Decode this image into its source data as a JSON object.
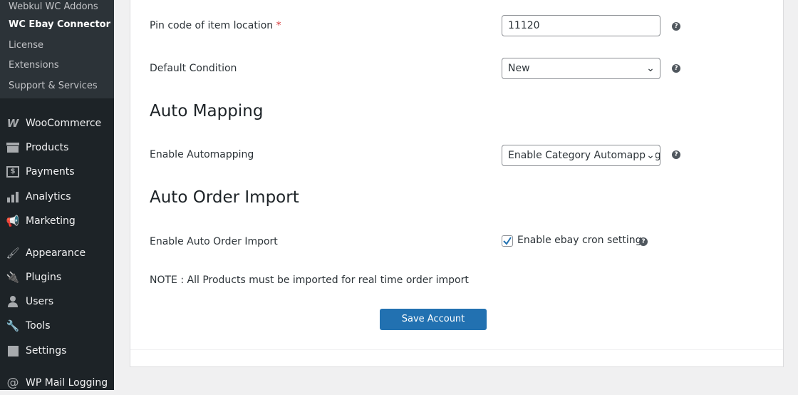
{
  "sidebar": {
    "submenu": [
      "Webkul WC Addons",
      "WC Ebay Connector",
      "License",
      "Extensions",
      "Support & Services"
    ],
    "menu": [
      "WooCommerce",
      "Products",
      "Payments",
      "Analytics",
      "Marketing",
      "Appearance",
      "Plugins",
      "Users",
      "Tools",
      "Settings",
      "WP Mail Logging"
    ]
  },
  "form": {
    "pin_label": "Pin code of item location",
    "required": "*",
    "pin_value": "11120",
    "condition_label": "Default Condition",
    "condition_value": "New",
    "auto_mapping_heading": "Auto Mapping",
    "automapping_label": "Enable Automapping",
    "automapping_value": "Enable Category Automapping",
    "auto_order_heading": "Auto Order Import",
    "auto_order_label": "Enable Auto Order Import",
    "cron_label": "Enable ebay cron setting",
    "cron_checked": true,
    "note": "NOTE : All Products must be imported for real time order import",
    "help": "?",
    "save": "Save Account"
  }
}
